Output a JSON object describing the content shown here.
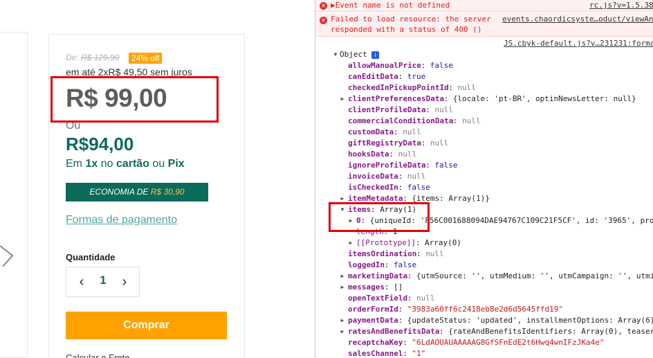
{
  "product": {
    "old_price_prefix": "De: ",
    "old_price": "R$ 129,90",
    "discount_badge": "24% off",
    "installments": "em até 2xR$ 49,50 sem juros",
    "price": "R$ 99,00",
    "or_label": "Ou",
    "pix_price": "R$94,00",
    "pix_line": {
      "prefix": "Em ",
      "times": "1x",
      "mid": " no ",
      "card": "cartão",
      "or": " ou ",
      "pix": "Pix"
    },
    "savings": {
      "label": "ECONOMIA DE ",
      "amount": "R$ 30,90"
    },
    "payment_link": "Formas de pagamento",
    "quantity_label": "Quantidade",
    "quantity": "1",
    "dec_symbol": "‹",
    "inc_symbol": "›",
    "buy_button": "Comprar",
    "shipping_label": "Calcular o Frete"
  },
  "console": {
    "errors": [
      {
        "text": "▶Event name is not defined",
        "source": "rc.js?v=1.5.38"
      },
      {
        "text_line1": "Failed to load resource: the server",
        "text_line2": "responded with a status of 400 ()",
        "source": "events.chaordicsyste…oduct/viewAn"
      }
    ],
    "source_link": "JS.cbyk-default.js?v…231231:forma",
    "object_label": "Object",
    "object_badge": "i",
    "props": [
      {
        "key": "allowManualPrice",
        "value": "false",
        "kind": "bool"
      },
      {
        "key": "canEditData",
        "value": "true",
        "kind": "bool"
      },
      {
        "key": "checkedInPickupPointId",
        "value": "null",
        "kind": "null"
      },
      {
        "key": "clientPreferencesData",
        "value": "{locale: 'pt-BR', optinNewsLetter: null}",
        "kind": "plain",
        "expandable": true
      },
      {
        "key": "clientProfileData",
        "value": "null",
        "kind": "null"
      },
      {
        "key": "commercialConditionData",
        "value": "null",
        "kind": "null"
      },
      {
        "key": "customData",
        "value": "null",
        "kind": "null"
      },
      {
        "key": "giftRegistryData",
        "value": "null",
        "kind": "null"
      },
      {
        "key": "hooksData",
        "value": "null",
        "kind": "null"
      },
      {
        "key": "ignoreProfileData",
        "value": "false",
        "kind": "bool"
      },
      {
        "key": "invoiceData",
        "value": "null",
        "kind": "null"
      },
      {
        "key": "isCheckedIn",
        "value": "false",
        "kind": "bool"
      },
      {
        "key": "itemMetadata",
        "value": "{items: Array(1)}",
        "kind": "plain",
        "expandable": true
      },
      {
        "key": "items",
        "value": "Array(1)",
        "kind": "plain",
        "expanded": true
      },
      {
        "key": "0",
        "value": "{uniqueId: 'F56C001688094DAE94767C109C21F5CF', id: '3965', pro",
        "kind": "plain",
        "expandable": true,
        "indent": 1
      },
      {
        "key": "length",
        "value": "1",
        "kind": "plain",
        "indent": 1,
        "dim": true
      },
      {
        "key": "[[Prototype]]",
        "value": "Array(0)",
        "kind": "plain",
        "expandable": true,
        "indent": 1,
        "dim": true
      },
      {
        "key": "itemsOrdination",
        "value": "null",
        "kind": "null"
      },
      {
        "key": "loggedIn",
        "value": "false",
        "kind": "bool"
      },
      {
        "key": "marketingData",
        "value": "{utmSource: '', utmMedium: '', utmCampaign: '', utmi",
        "kind": "plain",
        "expandable": true
      },
      {
        "key": "messages",
        "value": "[]",
        "kind": "plain",
        "expandable": true
      },
      {
        "key": "openTextField",
        "value": "null",
        "kind": "null"
      },
      {
        "key": "orderFormId",
        "value": "\"3983a60ff6c2418eb8e2d6d5645ffd19\"",
        "kind": "str"
      },
      {
        "key": "paymentData",
        "value": "{updateStatus: 'updated', installmentOptions: Array(6)",
        "kind": "plain",
        "expandable": true
      },
      {
        "key": "ratesAndBenefitsData",
        "value": "{rateAndBenefitsIdentifiers: Array(0), teaser",
        "kind": "plain",
        "expandable": true
      },
      {
        "key": "recaptchaKey",
        "value": "\"6LdAOUAUAAAAAG8GfSFnEdE2t6Hwq4wnIFzJKa4e\"",
        "kind": "str"
      },
      {
        "key": "salesChannel",
        "value": "\"1\"",
        "kind": "str"
      }
    ]
  },
  "colors": {
    "accent_green": "#0d6b5b",
    "buy_orange": "#ffa200",
    "badge_orange": "#ffa500",
    "highlight_red": "#e00000",
    "error_red": "#e02020"
  }
}
